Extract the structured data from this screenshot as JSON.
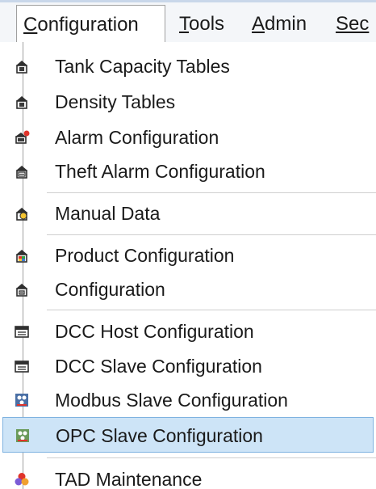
{
  "menubar": {
    "items": [
      {
        "mnemonic": "C",
        "rest": "onfiguration"
      },
      {
        "mnemonic": "T",
        "rest": "ools"
      },
      {
        "mnemonic": "A",
        "rest": "dmin"
      },
      {
        "mnemonic": "",
        "rest": "Sec"
      }
    ]
  },
  "dropdown": {
    "items": [
      {
        "label": "Tank Capacity Tables",
        "icon": "tank-table-icon"
      },
      {
        "label": "Density Tables",
        "icon": "tank-table-icon"
      },
      {
        "label": "Alarm Configuration",
        "icon": "alarm-icon"
      },
      {
        "label": "Theft Alarm Configuration",
        "icon": "theft-alarm-icon"
      },
      {
        "label": "Manual Data",
        "icon": "manual-data-icon"
      },
      {
        "label": "Product Configuration",
        "icon": "product-icon"
      },
      {
        "label": "Configuration",
        "icon": "configuration-icon"
      },
      {
        "label": "DCC Host Configuration",
        "icon": "dcc-host-icon"
      },
      {
        "label": "DCC Slave Configuration",
        "icon": "dcc-slave-icon"
      },
      {
        "label": "Modbus Slave Configuration",
        "icon": "modbus-icon"
      },
      {
        "label": "OPC Slave Configuration",
        "icon": "opc-icon"
      },
      {
        "label": "TAD Maintenance",
        "icon": "tad-maintenance-icon"
      }
    ],
    "selected_label": "OPC Slave Configuration"
  },
  "colors": {
    "selection_bg": "#cde4f7",
    "selection_border": "#7fb2e0",
    "menubar_bg": "#f4f6f9"
  }
}
